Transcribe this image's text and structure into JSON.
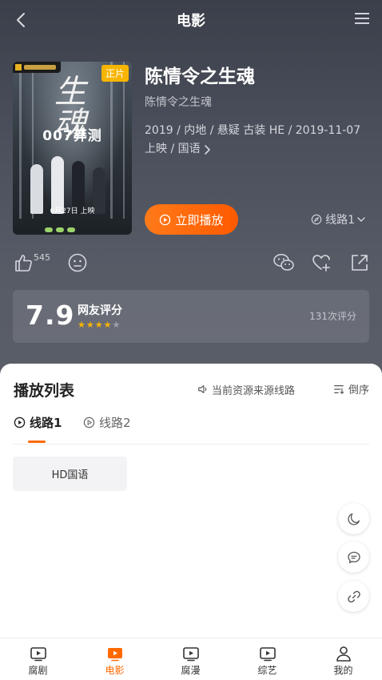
{
  "header": {
    "title": "电影"
  },
  "movie": {
    "title": "陈情令之生魂",
    "subtitle": "陈情令之生魂",
    "meta_line1": "2019 / 内地 / 悬疑 古装 HE / 2019-11-07",
    "meta_line2": "上映 / 国语",
    "poster": {
      "badge": "正片",
      "calligraphy": "生魂",
      "tagline": "007莽测",
      "date": "6月27日 上映"
    }
  },
  "actions": {
    "play_label": "立即播放",
    "route_select": "线路1",
    "like_count": "545"
  },
  "rating": {
    "score": "7.9",
    "label": "网友评分",
    "stars": "★★★★",
    "stars_off": "★",
    "count": "131次评分"
  },
  "playlist": {
    "title": "播放列表",
    "source_hint": "当前资源来源线路",
    "sort_label": "倒序",
    "routes": [
      {
        "label": "线路1",
        "active": true
      },
      {
        "label": "线路2",
        "active": false
      }
    ],
    "episodes": [
      {
        "label": "HD国语"
      }
    ]
  },
  "tabbar": {
    "items": [
      {
        "label": "腐剧",
        "icon": "tv-play-icon",
        "active": false
      },
      {
        "label": "电影",
        "icon": "movie-play-icon",
        "active": true
      },
      {
        "label": "腐漫",
        "icon": "tv-play-icon",
        "active": false
      },
      {
        "label": "综艺",
        "icon": "tv-play-icon",
        "active": false
      },
      {
        "label": "我的",
        "icon": "user-icon",
        "active": false
      }
    ]
  },
  "colors": {
    "accent": "#ff6a00",
    "star": "#f7b500",
    "hero_bg": "#4a4f5b"
  }
}
